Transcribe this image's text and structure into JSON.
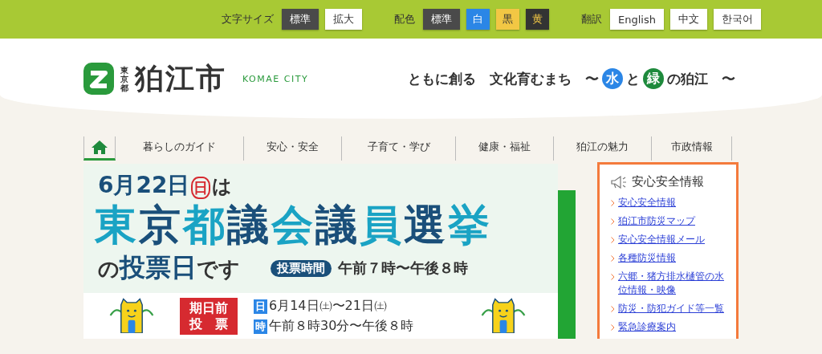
{
  "top_bar": {
    "font_size": {
      "label": "文字サイズ",
      "options": [
        {
          "label": "標準",
          "selected": true
        },
        {
          "label": "拡大",
          "selected": false
        }
      ]
    },
    "color_scheme": {
      "label": "配色",
      "options": [
        {
          "label": "標準",
          "color": "#4a4a4a",
          "kind": "light"
        },
        {
          "label": "白",
          "color": "#2b86e6",
          "kind": "light"
        },
        {
          "label": "黒",
          "color": "#f2c744",
          "kind": "dark"
        },
        {
          "label": "黄",
          "color": "#333333",
          "kind": "yellow"
        }
      ]
    },
    "translation": {
      "label": "翻訳",
      "options": [
        {
          "label": "English"
        },
        {
          "label": "中文"
        },
        {
          "label": "한국어"
        }
      ]
    }
  },
  "header": {
    "prefecture": "東京都",
    "city": "狛江市",
    "city_en": "KOMAE CITY",
    "tagline": [
      {
        "kind": "text",
        "text": "ともに創る　文化育むまち　〜"
      },
      {
        "kind": "circle",
        "text": "水",
        "color": "#2b86e6"
      },
      {
        "kind": "text",
        "text": "と"
      },
      {
        "kind": "circle",
        "text": "緑",
        "color": "#1e8a3c"
      },
      {
        "kind": "text",
        "text": "の狛江　〜"
      }
    ]
  },
  "nav": {
    "home_selected": true,
    "items": [
      {
        "label": "暮らしのガイド",
        "selected": false
      },
      {
        "label": "安心・安全",
        "selected": false
      },
      {
        "label": "子育て・学び",
        "selected": false
      },
      {
        "label": "健康・福祉",
        "selected": false
      },
      {
        "label": "狛江の魅力",
        "selected": false
      },
      {
        "label": "市政情報",
        "selected": false
      }
    ]
  },
  "banner": {
    "date": "6月22日",
    "weekday": "日",
    "date_suffix": "は",
    "title": "東京都議会議員選挙",
    "subtitle": "の**投票日**です",
    "hours_label": "投票時間",
    "hours": "午前７時〜午後８時",
    "early_vote": "期日前",
    "early_vote_2": "投　票",
    "early_rows": [
      {
        "badge": "日",
        "text": "6月14日㈯〜21日㈯"
      },
      {
        "badge": "時",
        "text": "午前８時30分〜午後８時"
      }
    ]
  },
  "safety": {
    "title": "安心安全情報",
    "links": [
      "安心安全情報",
      "狛江市防災マップ",
      "安心安全情報メール",
      "各種防災情報",
      "六郷・猪方排水樋管の水位情報・映像",
      "防災・防犯ガイド等一覧",
      "緊急診療案内"
    ]
  }
}
